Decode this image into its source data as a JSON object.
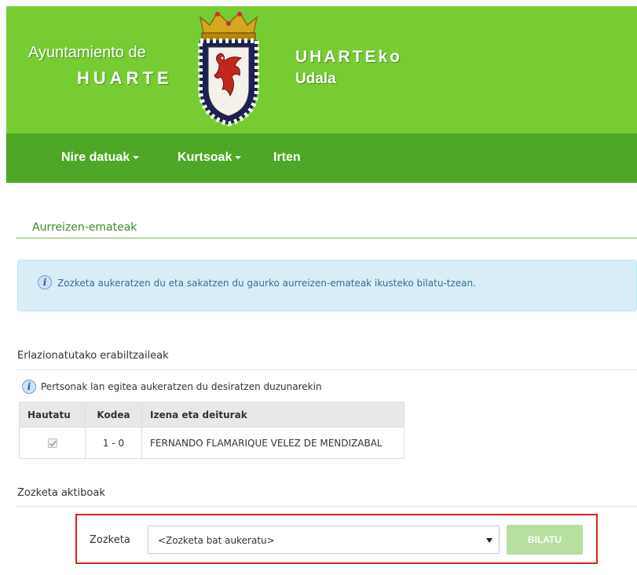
{
  "header": {
    "left_line1": "Ayuntamiento de",
    "left_line2": "HUARTE",
    "right_line1": "UHARTEko",
    "right_line2": "Udala",
    "colors": {
      "header_bg": "#77cc33",
      "nav_bg": "#4ea726"
    }
  },
  "nav": {
    "items": [
      {
        "label": "Nire datuak",
        "dropdown": true
      },
      {
        "label": "Kurtsoak",
        "dropdown": true
      },
      {
        "label": "Irten",
        "dropdown": false
      }
    ]
  },
  "page": {
    "title": "Aurreizen-emateak",
    "alert": "Zozketa aukeratzen du eta sakatzen du gaurko aurreizen-emateak ikusteko bilatu-tzean."
  },
  "users_section": {
    "title": "Erlazionatutako erabiltzaileak",
    "hint": "Pertsonak lan egitea aukeratzen du desiratzen duzunarekin",
    "columns": [
      "Hautatu",
      "Kodea",
      "Izena eta deiturak"
    ],
    "rows": [
      {
        "checked": true,
        "code": "1 - 0",
        "name": "FERNANDO FLAMARIQUE VELEZ DE MENDIZABAL"
      }
    ]
  },
  "active_section": {
    "title": "Zozketa aktiboak",
    "label": "Zozketa",
    "select_value": "<Zozketa bat aukeratu>",
    "button": "BILATU"
  }
}
